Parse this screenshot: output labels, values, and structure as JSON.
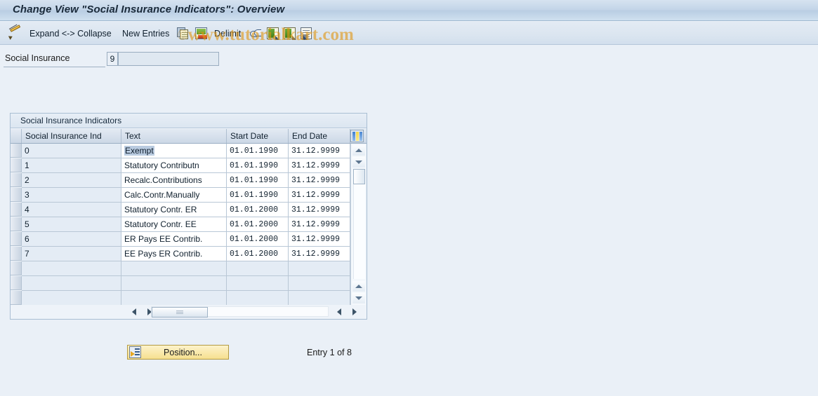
{
  "window": {
    "title": "Change View \"Social Insurance Indicators\": Overview"
  },
  "toolbar": {
    "items": [
      {
        "name": "expand-collapse",
        "label": "Expand <-> Collapse",
        "icon": "pencil-icon"
      },
      {
        "name": "new-entries",
        "label": "New Entries",
        "icon": ""
      },
      {
        "name": "copy-as",
        "label": "",
        "icon": "copy-icon"
      },
      {
        "name": "undo-delete",
        "label": "",
        "icon": "delete-row-icon"
      },
      {
        "name": "delimit",
        "label": "Delimit",
        "icon": ""
      },
      {
        "name": "select-all-toggle",
        "label": "",
        "icon": "double-arrow-icon"
      },
      {
        "name": "previous-entry",
        "label": "",
        "icon": "green-doc-left-icon"
      },
      {
        "name": "next-entry",
        "label": "",
        "icon": "green-doc-right-icon"
      },
      {
        "name": "details",
        "label": "",
        "icon": "lines-doc-icon"
      }
    ]
  },
  "watermark": {
    "copyright": "©",
    "text": "www.tutorialkart.com"
  },
  "field": {
    "label": "Social Insurance",
    "key_value": "9",
    "input_value": "",
    "input_placeholder": ""
  },
  "table": {
    "caption": "Social Insurance Indicators",
    "columns": [
      "Social Insurance Ind",
      "Text",
      "Start Date",
      "End Date"
    ],
    "settings_icon": "table-settings-icon",
    "rows": [
      {
        "ind": "0",
        "text": "Exempt",
        "start": "01.01.1990",
        "end": "31.12.9999",
        "selected": true
      },
      {
        "ind": "1",
        "text": "Statutory Contributn",
        "start": "01.01.1990",
        "end": "31.12.9999",
        "selected": false
      },
      {
        "ind": "2",
        "text": "Recalc.Contributions",
        "start": "01.01.1990",
        "end": "31.12.9999",
        "selected": false
      },
      {
        "ind": "3",
        "text": "Calc.Contr.Manually",
        "start": "01.01.1990",
        "end": "31.12.9999",
        "selected": false
      },
      {
        "ind": "4",
        "text": "Statutory Contr. ER",
        "start": "01.01.2000",
        "end": "31.12.9999",
        "selected": false
      },
      {
        "ind": "5",
        "text": "Statutory Contr. EE",
        "start": "01.01.2000",
        "end": "31.12.9999",
        "selected": false
      },
      {
        "ind": "6",
        "text": "ER Pays EE Contrib.",
        "start": "01.01.2000",
        "end": "31.12.9999",
        "selected": false
      },
      {
        "ind": "7",
        "text": "EE Pays ER Contrib.",
        "start": "01.01.2000",
        "end": "31.12.9999",
        "selected": false
      },
      {
        "ind": "",
        "text": "",
        "start": "",
        "end": "",
        "selected": false
      },
      {
        "ind": "",
        "text": "",
        "start": "",
        "end": "",
        "selected": false
      },
      {
        "ind": "",
        "text": "",
        "start": "",
        "end": "",
        "selected": false
      }
    ]
  },
  "footer": {
    "position_button": "Position...",
    "entry_count": "Entry 1 of 8"
  },
  "colors": {
    "title_bar": "#c3d5e8",
    "page_background": "#eaf0f7",
    "accent_yellow": "#f6e08f",
    "row_key_bg": "#e4ecf5",
    "selection_highlight": "#b9cbe0",
    "watermark": "#e09614"
  }
}
